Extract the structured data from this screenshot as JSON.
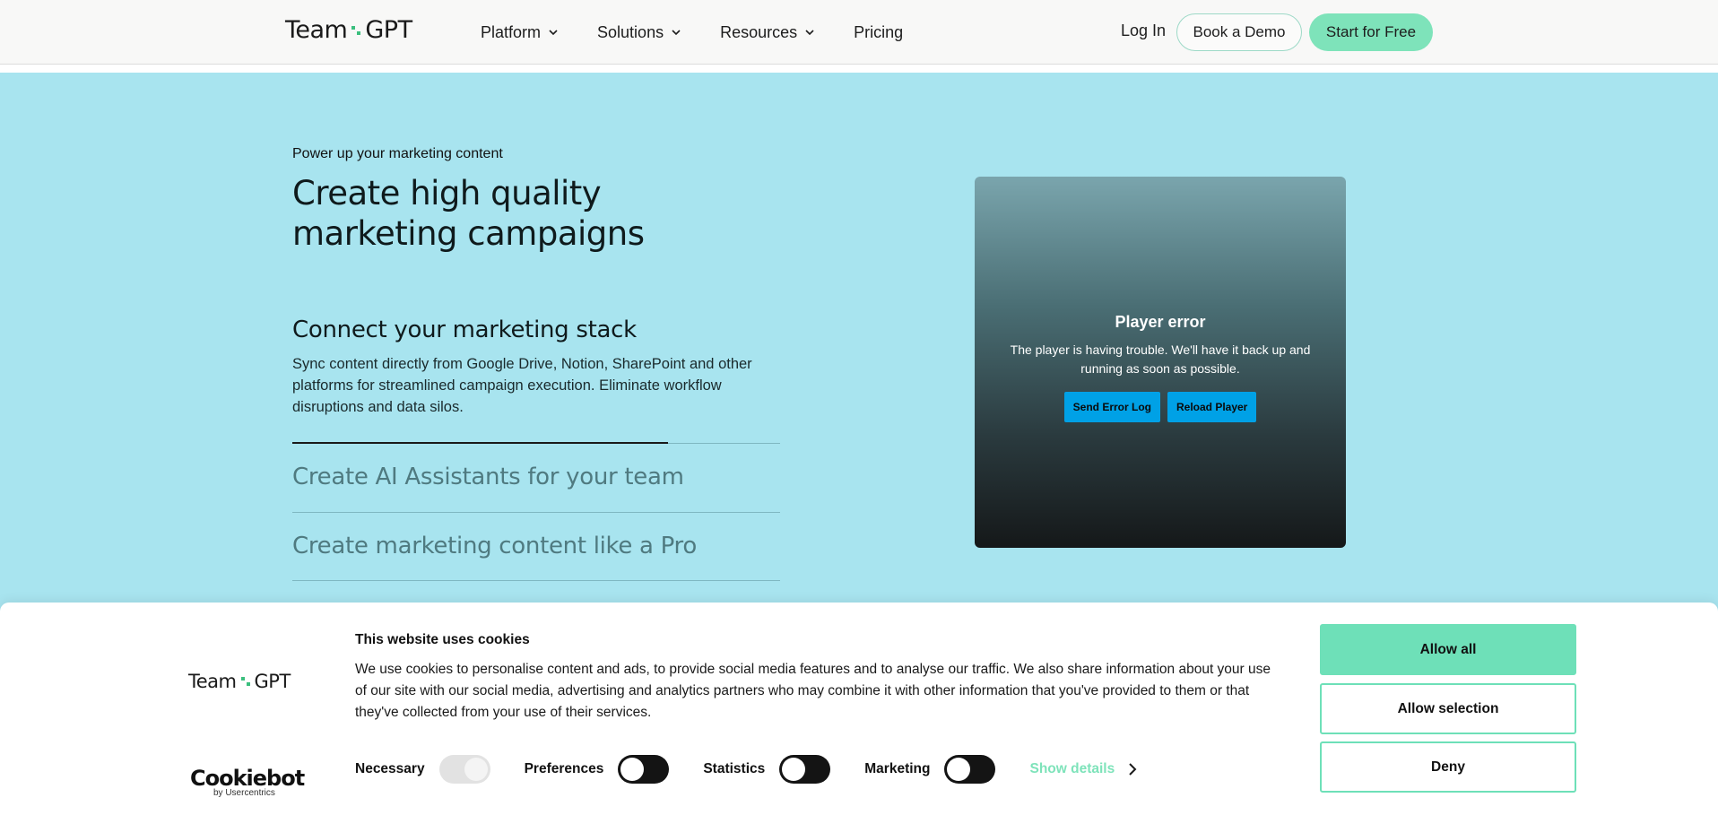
{
  "nav": {
    "logo_left": "Team",
    "logo_right": "GPT",
    "links": [
      {
        "label": "Platform",
        "has_dropdown": true
      },
      {
        "label": "Solutions",
        "has_dropdown": true
      },
      {
        "label": "Resources",
        "has_dropdown": true
      },
      {
        "label": "Pricing",
        "has_dropdown": false
      }
    ],
    "login_label": "Log In",
    "demo_label": "Book a Demo",
    "free_label": "Start for Free"
  },
  "hero": {
    "eyebrow": "Power up your marketing content",
    "title": "Create high quality marketing campaigns",
    "active_feature": {
      "title": "Connect your marketing stack",
      "description": "Sync content directly from Google Drive, Notion, SharePoint and other platforms for streamlined campaign execution. Eliminate workflow disruptions and data silos.",
      "progress": 0.77
    },
    "accordion": [
      {
        "label": "Create AI Assistants for your team"
      },
      {
        "label": "Create marketing content like a Pro"
      }
    ]
  },
  "player": {
    "title": "Player error",
    "message": "The player is having trouble. We'll have it back up and running as soon as possible.",
    "send_log_label": "Send Error Log",
    "reload_label": "Reload Player"
  },
  "cookie": {
    "logo_left": "Team",
    "logo_right": "GPT",
    "title": "This website uses cookies",
    "text": "We use cookies to personalise content and ads, to provide social media features and to analyse our traffic. We also share information about your use of our site with our social media, advertising and analytics partners who may combine it with other information that you've provided to them or that they've collected from your use of their services.",
    "toggles": [
      {
        "label": "Necessary",
        "on": true,
        "disabled": true
      },
      {
        "label": "Preferences",
        "on": false,
        "disabled": false
      },
      {
        "label": "Statistics",
        "on": false,
        "disabled": false
      },
      {
        "label": "Marketing",
        "on": false,
        "disabled": false
      }
    ],
    "show_details_label": "Show details",
    "allow_all_label": "Allow all",
    "allow_selection_label": "Allow selection",
    "deny_label": "Deny",
    "cookiebot_name": "Cookiebot",
    "cookiebot_by": "by Usercentrics"
  },
  "colors": {
    "hero_bg": "#a8e4ef",
    "accent_green": "#7ee3ba",
    "player_button": "#00a1e6"
  }
}
